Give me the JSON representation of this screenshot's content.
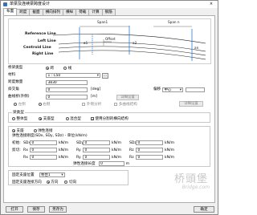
{
  "window": {
    "title": "单梁及连续梁跨度设计",
    "close": "×"
  },
  "tabs": [
    {
      "label": "布置",
      "active": true
    },
    {
      "label": "跨度",
      "active": false
    },
    {
      "label": "截面",
      "active": false
    },
    {
      "label": "横向排列",
      "active": false
    },
    {
      "label": "横纵",
      "active": false
    },
    {
      "label": "荷载",
      "active": false
    },
    {
      "label": "计算",
      "active": false
    },
    {
      "label": "钢筋",
      "active": false
    }
  ],
  "diagram": {
    "span1": "Span1",
    "spann": "Span n",
    "reference_line": "Reference Line",
    "left_line": "Left Line",
    "centroid_line": "Centroid Line",
    "right_line": "Right Line",
    "offset": "Offset",
    "a1": "a1",
    "a2": "a2",
    "an": "an"
  },
  "bridge_type": {
    "label": "桥梁类型",
    "option1": "跨",
    "option2": "线",
    "option1_selected": true
  },
  "form": {
    "material_label": "材料",
    "material_value": "1 : C50",
    "material_btn": "...",
    "span_count_label": "跨度数量",
    "span_count_value": "3830",
    "angle_label": "斜交角",
    "angle_value": "0",
    "angle_unit": "[deg]",
    "offset_label": "偏移",
    "offset_value": "中心",
    "curve_label": "曲线桥(外侧)",
    "curve_value": "0",
    "curve_unit": "[m]",
    "curve_btn": "详细设置",
    "left_label": "左侧",
    "right_label": "右侧",
    "outer_check": "外侧分析",
    "multiline_check": "多曲线结构",
    "detail_btn": "详细设置"
  },
  "beam_type": {
    "title": "梁类型",
    "option_whole": "整体型",
    "option_box": "支座型",
    "option_mixed": "混合型",
    "check_use_section": "使用分割的横向结构",
    "box_selected": true
  },
  "support": {
    "option_support": "支座",
    "option_spring": "弹性连接",
    "support_selected": true,
    "elastic_label": "弹性连接刚度(SDx, SDy, SDz) - 单位(kN/m)",
    "rows": [
      {
        "label": "初始:",
        "x_label": "SDx",
        "y_label": "SDy",
        "z_label": "SDz",
        "x": "0",
        "y": "0",
        "z": "0",
        "unit": "kN/m"
      },
      {
        "label": "剪切:",
        "x_label": "Rx",
        "y_label": "Ry",
        "z_label": "Rz",
        "x": "0",
        "y": "0",
        "z": "0",
        "unit": "kN/m"
      },
      {
        "label": "",
        "x_label": "Rx",
        "y_label": "Ry",
        "z_label": "Rz",
        "x": "0",
        "y": "0",
        "z": "0",
        "unit": "kN/m"
      }
    ],
    "elastic_end_label": "弹性连接长度",
    "elastic_end_value": "0",
    "elastic_end_unit": "m"
  },
  "fixed_support": {
    "label": "固定支座位置",
    "value": "桥台1",
    "direction_label": "固定支座连接方向",
    "option_normal": "方向",
    "option_tangent": "切向",
    "normal_selected": true
  },
  "watermark": {
    "brand": "桥頭堡",
    "url": "Bridge.com"
  },
  "footer": {
    "open": "打开",
    "save": "保存",
    "save_as": "另存为",
    "ok": "确定"
  }
}
